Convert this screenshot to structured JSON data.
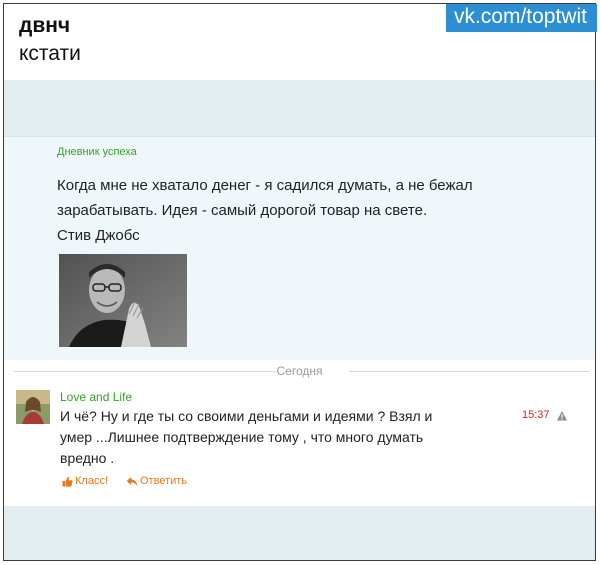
{
  "header": {
    "title": "двнч",
    "caption": "кстати",
    "watermark": "vk.com/toptwit"
  },
  "post": {
    "source": "Дневник успеха",
    "lines": [
      "Когда мне не хватало денег - я садился думать, а не бежал",
      "зарабатывать. Идея - самый дорогой товар на свете.",
      "Стив Джобс"
    ]
  },
  "divider": {
    "label": "Сегодня"
  },
  "comment": {
    "author": "Love and Life",
    "lines": [
      "И чё? Ну и где ты со своими деньгами и идеями ? Взял и",
      "умер ...Лишнее подтверждение тому , что много думать",
      "вредно ."
    ],
    "time": "15:37",
    "like_label": "Класс!",
    "reply_label": "Ответить"
  },
  "colors": {
    "accent_green": "#3aa12a",
    "accent_orange": "#e8781f",
    "time_red": "#d0261f",
    "watermark_blue": "#2c8fd4"
  }
}
